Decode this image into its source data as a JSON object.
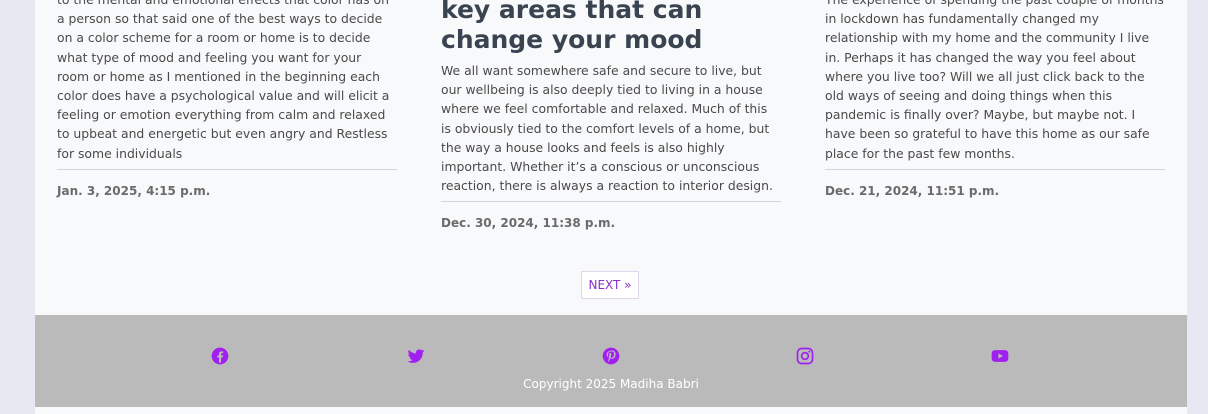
{
  "posts": [
    {
      "excerpt": "to the mental and emotional effects that color has on a person so that said one of the best ways to decide on a color scheme for a room or home is to decide what type of mood and feeling you want for your room or home as I mentioned in the beginning each color does have a psychological value and will elicit a feeling or emotion everything from calm and relaxed to upbeat and energetic but even angry and Restless for some individuals",
      "date": "Jan. 3, 2025, 4:15 p.m."
    },
    {
      "title": "key areas that can change your mood",
      "excerpt": "We all want somewhere safe and secure to live, but our wellbeing is also deeply tied to living in a house where we feel comfortable and relaxed. Much of this is obviously tied to the comfort levels of a home, but the way a house looks and feels is also highly important. Whether it’s a conscious or unconscious reaction, there is always a reaction to interior design.",
      "date": "Dec. 30, 2024, 11:38 p.m."
    },
    {
      "excerpt": "The experience of spending the past couple of months in lockdown has fundamentally changed my relationship with my home and the community I live in. Perhaps it has changed the way you feel about where you live too? Will we all just click back to the old ways of seeing and doing things when this pandemic is finally over? Maybe, but maybe not. I have been so grateful to have this home as our safe place for the past few months.",
      "date": "Dec. 21, 2024, 11:51 p.m."
    }
  ],
  "pagination": {
    "next_label": "NEXT »"
  },
  "footer": {
    "social": [
      "facebook-icon",
      "twitter-icon",
      "pinterest-icon",
      "instagram-icon",
      "youtube-icon"
    ],
    "icon_color": "#a020f0",
    "background": "#bababb",
    "copyright": "Copyright 2025 Madiha Babri"
  }
}
